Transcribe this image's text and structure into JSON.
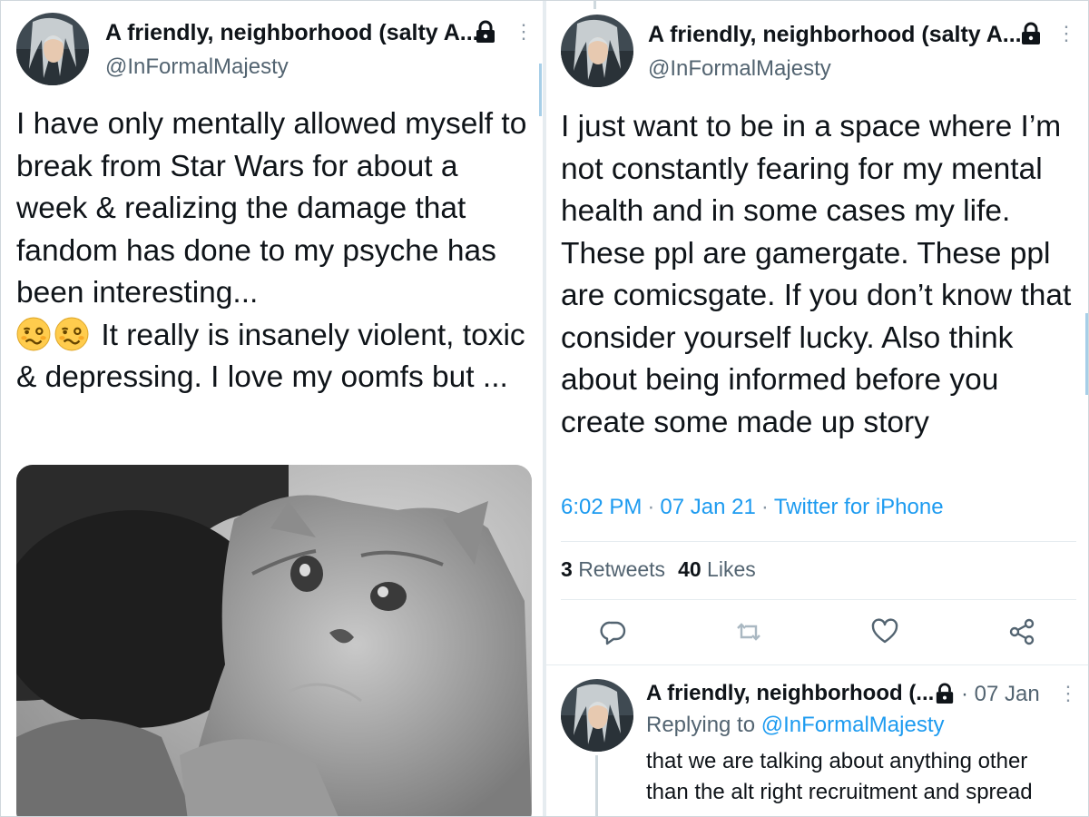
{
  "left_tweet": {
    "display_name": "A friendly, neighborhood (salty A...",
    "handle": "@InFormalMajesty",
    "text_before_emoji": "I have only mentally allowed myself to break from Star Wars for about a week & realizing the damage that fandom has done to my psyche has been interesting...",
    "text_after_emoji": "It really is insanely violent, toxic & depressing. I love my oomfs but ...",
    "emoji_names": [
      "woozy-face-emoji",
      "woozy-face-emoji"
    ],
    "media": "cat-image"
  },
  "right_tweet": {
    "display_name": "A friendly, neighborhood (salty A...",
    "handle": "@InFormalMajesty",
    "text": "I just want to be in a space where I’m not constantly fearing for my mental health and in some cases my life. These ppl are gamergate. These ppl are comicsgate. If you don’t know that consider yourself lucky. Also think about being informed before you create some made up story",
    "time": "6:02 PM",
    "date": "07 Jan 21",
    "source": "Twitter for iPhone",
    "retweets_count": "3",
    "retweets_label": "Retweets",
    "likes_count": "40",
    "likes_label": "Likes",
    "actions": [
      "reply-icon",
      "retweet-icon",
      "like-icon",
      "share-icon"
    ]
  },
  "reply_tweet": {
    "display_name": "A friendly, neighborhood (...",
    "date": "07 Jan",
    "replying_label": "Replying to",
    "replying_to": "@InFormalMajesty",
    "text": "that we are talking about anything other than the alt right recruitment and spread"
  },
  "colors": {
    "link": "#1d9bf0",
    "secondary_text": "#536471",
    "primary_text": "#0f1419",
    "divider": "#e6ecf0"
  },
  "separator": "·"
}
